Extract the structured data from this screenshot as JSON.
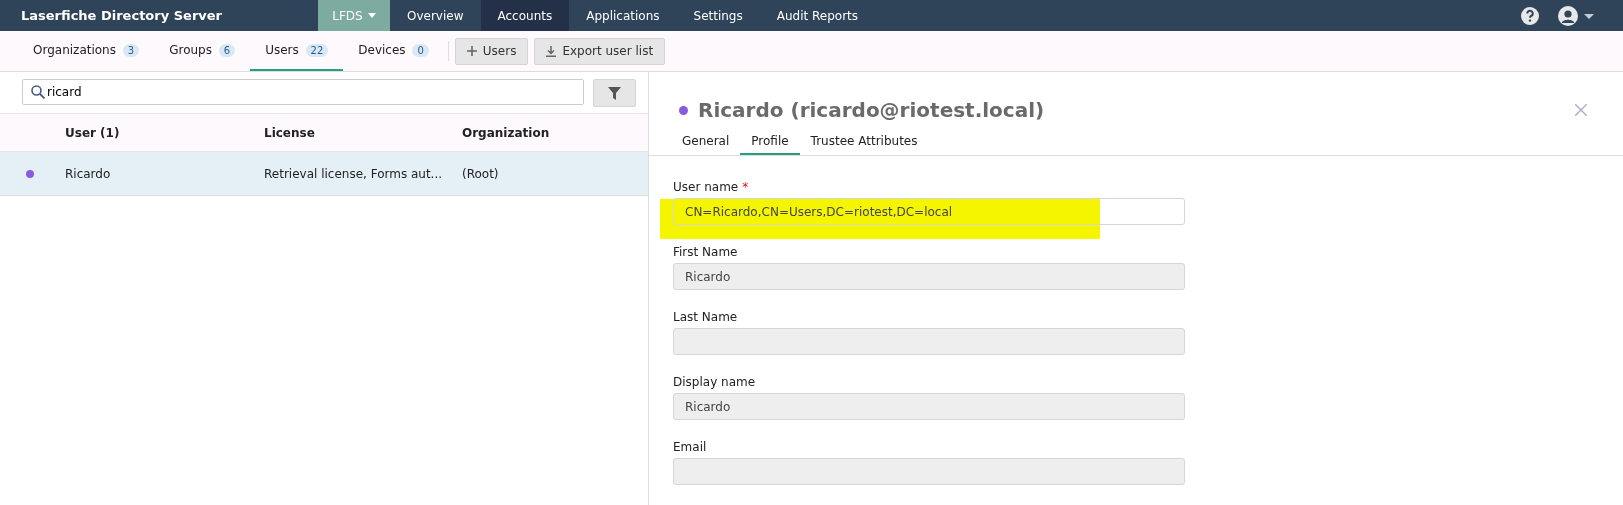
{
  "app_title": "Laserfiche Directory Server",
  "product_menu": {
    "label": "LFDS"
  },
  "nav": [
    {
      "label": "Overview",
      "selected": false
    },
    {
      "label": "Accounts",
      "selected": true
    },
    {
      "label": "Applications",
      "selected": false
    },
    {
      "label": "Settings",
      "selected": false
    },
    {
      "label": "Audit Reports",
      "selected": false
    }
  ],
  "subtabs": [
    {
      "label": "Organizations",
      "count": "3",
      "selected": false
    },
    {
      "label": "Groups",
      "count": "6",
      "selected": false
    },
    {
      "label": "Users",
      "count": "22",
      "selected": true
    },
    {
      "label": "Devices",
      "count": "0",
      "selected": false
    }
  ],
  "actions": [
    {
      "kind": "add",
      "label": "Users"
    },
    {
      "kind": "download",
      "label": "Export user list"
    }
  ],
  "search": {
    "value": "ricard"
  },
  "table": {
    "columns": [
      "User (1)",
      "License",
      "Organization"
    ],
    "rows": [
      {
        "color": "#8a5be0",
        "selected": true,
        "cells": [
          "Ricardo",
          "Retrieval license, Forms aut...",
          "(Root)"
        ]
      }
    ]
  },
  "detail": {
    "color": "#8a5be0",
    "title": "Ricardo (ricardo@riotest.local)",
    "tabs": [
      {
        "label": "General",
        "selected": false
      },
      {
        "label": "Profile",
        "selected": true
      },
      {
        "label": "Trustee Attributes",
        "selected": false
      }
    ],
    "fields": [
      {
        "label": "User name",
        "required_mark": "*",
        "highlighted": true,
        "value": "CN=Ricardo,CN=Users,DC=riotest,DC=local"
      },
      {
        "label": "First Name",
        "value": "Ricardo"
      },
      {
        "label": "Last Name"
      },
      {
        "label": "Display name",
        "value": "Ricardo"
      },
      {
        "label": "Email"
      }
    ]
  }
}
